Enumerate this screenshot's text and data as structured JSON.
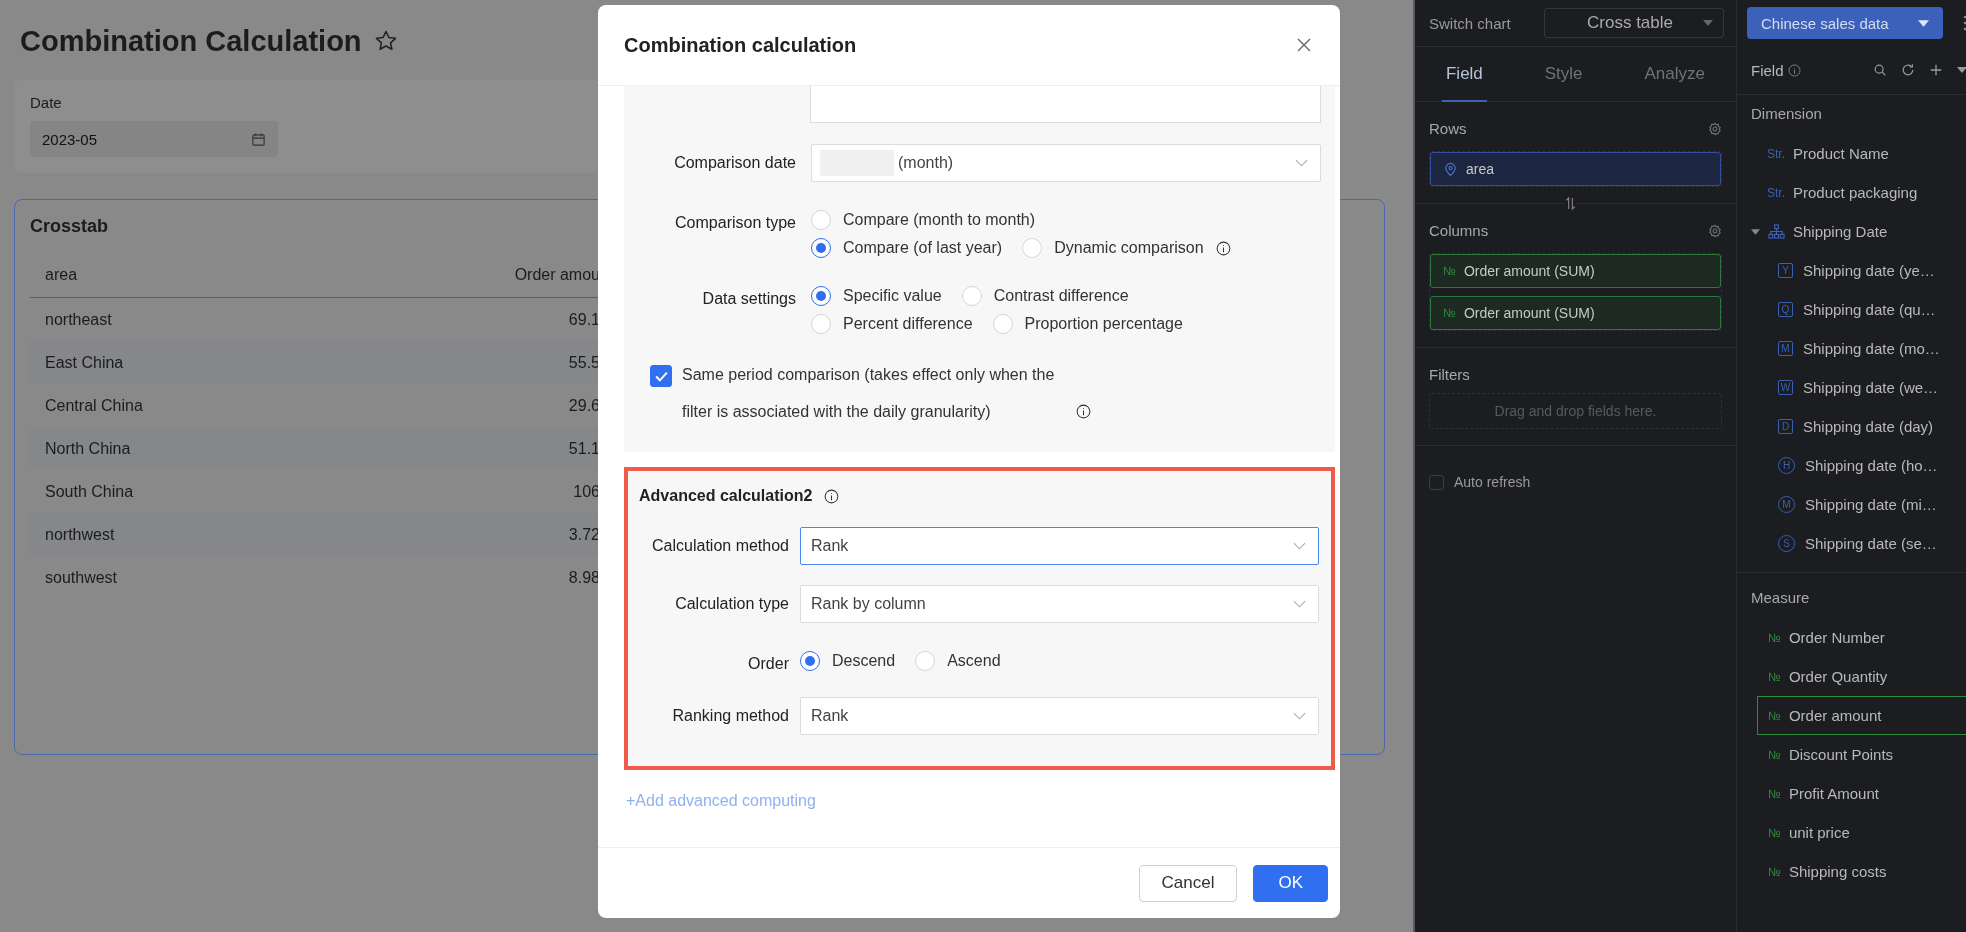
{
  "page": {
    "title": "Combination Calculation",
    "favorite": false
  },
  "date_filter": {
    "label": "Date",
    "value": "2023-05"
  },
  "crosstab": {
    "title": "Crosstab",
    "columns": [
      "area",
      "Order amou"
    ],
    "rows": [
      [
        "northeast",
        "69.1"
      ],
      [
        "East China",
        "55.5"
      ],
      [
        "Central China",
        "29.6"
      ],
      [
        "North China",
        "51.1"
      ],
      [
        "South China",
        "106"
      ],
      [
        "northwest",
        "3.72"
      ],
      [
        "southwest",
        "8.98"
      ]
    ]
  },
  "dialog": {
    "title": "Combination calculation",
    "sections": [
      {
        "highlighted": false,
        "rows": [
          {
            "kind": "select",
            "label": "Comparison date",
            "value": "(month)",
            "redacted": true,
            "focused": false
          },
          {
            "kind": "radio",
            "label": "Comparison type",
            "lines": [
              [
                {
                  "label": "Compare (month to month)",
                  "selected": false,
                  "info": false
                }
              ],
              [
                {
                  "label": "Compare (of last year)",
                  "selected": true,
                  "info": false
                },
                {
                  "label": "Dynamic comparison",
                  "selected": false,
                  "info": true
                }
              ]
            ]
          },
          {
            "kind": "radio",
            "label": "Data settings",
            "lines": [
              [
                {
                  "label": "Specific value",
                  "selected": true,
                  "info": false
                },
                {
                  "label": "Contrast difference",
                  "selected": false,
                  "info": false
                }
              ],
              [
                {
                  "label": "Percent difference",
                  "selected": false,
                  "info": false
                },
                {
                  "label": "Proportion percentage",
                  "selected": false,
                  "info": false
                }
              ]
            ]
          },
          {
            "kind": "checkbox",
            "label": "Same period comparison (takes effect only when the filter is associated with the daily granularity)",
            "checked": true,
            "info": true
          }
        ]
      },
      {
        "title": "Advanced calculation2",
        "highlighted": true,
        "info": true,
        "rows": [
          {
            "kind": "select",
            "label": "Calculation method",
            "value": "Rank",
            "redacted": false,
            "focused": true
          },
          {
            "kind": "select",
            "label": "Calculation type",
            "value": "Rank by column",
            "redacted": false,
            "focused": false
          },
          {
            "kind": "radio",
            "label": "Order",
            "lines": [
              [
                {
                  "label": "Descend",
                  "selected": true,
                  "info": false
                },
                {
                  "label": "Ascend",
                  "selected": false,
                  "info": false
                }
              ]
            ]
          },
          {
            "kind": "select",
            "label": "Ranking method",
            "value": "Rank",
            "redacted": false,
            "focused": false
          }
        ]
      }
    ],
    "add_link": "+Add advanced computing",
    "buttons": [
      {
        "label": "Cancel",
        "kind": "default"
      },
      {
        "label": "OK",
        "kind": "primary"
      }
    ]
  },
  "chart_panel": {
    "switch_label": "Switch chart",
    "chart_type": "Cross table",
    "tabs": [
      {
        "label": "Field",
        "selected": true
      },
      {
        "label": "Style",
        "selected": false
      },
      {
        "label": "Analyze",
        "selected": false
      }
    ],
    "rows": {
      "label": "Rows",
      "fields": [
        {
          "label": "area",
          "kind": "dimension"
        }
      ]
    },
    "columns": {
      "label": "Columns",
      "fields": [
        {
          "label": "Order amount (SUM)",
          "kind": "measure",
          "type_label": "№"
        },
        {
          "label": "Order amount (SUM)",
          "kind": "measure",
          "type_label": "№"
        }
      ]
    },
    "filters": {
      "label": "Filters",
      "hint": "Drag and drop fields here."
    },
    "auto_refresh": {
      "label": "Auto refresh",
      "checked": false
    }
  },
  "field_panel": {
    "dataset": "Chinese sales data",
    "title": "Field",
    "dimension": {
      "title": "Dimension",
      "items": [
        {
          "kind": "string",
          "type_label": "Str.",
          "label": "Product Name"
        },
        {
          "kind": "string",
          "type_label": "Str.",
          "label": "Product packaging"
        },
        {
          "kind": "hierarchy",
          "label": "Shipping Date",
          "expanded": true,
          "children": [
            {
              "kind": "date",
              "type_label": "Y",
              "label": "Shipping date (ye…"
            },
            {
              "kind": "date",
              "type_label": "Q",
              "label": "Shipping date (qu…"
            },
            {
              "kind": "date",
              "type_label": "M",
              "label": "Shipping date (mo…"
            },
            {
              "kind": "date",
              "type_label": "W",
              "label": "Shipping date (we…"
            },
            {
              "kind": "date",
              "type_label": "D",
              "label": "Shipping date (day)"
            },
            {
              "kind": "time",
              "type_label": "H",
              "label": "Shipping date (ho…"
            },
            {
              "kind": "time",
              "type_label": "M",
              "label": "Shipping date (mi…"
            },
            {
              "kind": "time",
              "type_label": "S",
              "label": "Shipping date (se…"
            }
          ]
        }
      ]
    },
    "measure": {
      "title": "Measure",
      "items": [
        {
          "type_label": "№",
          "label": "Order Number",
          "selected": false
        },
        {
          "type_label": "№",
          "label": "Order Quantity",
          "selected": false
        },
        {
          "type_label": "№",
          "label": "Order amount",
          "selected": true
        },
        {
          "type_label": "№",
          "label": "Discount Points",
          "selected": false
        },
        {
          "type_label": "№",
          "label": "Profit Amount",
          "selected": false
        },
        {
          "type_label": "№",
          "label": "unit price",
          "selected": false
        },
        {
          "type_label": "№",
          "label": "Shipping costs",
          "selected": false
        }
      ]
    }
  }
}
